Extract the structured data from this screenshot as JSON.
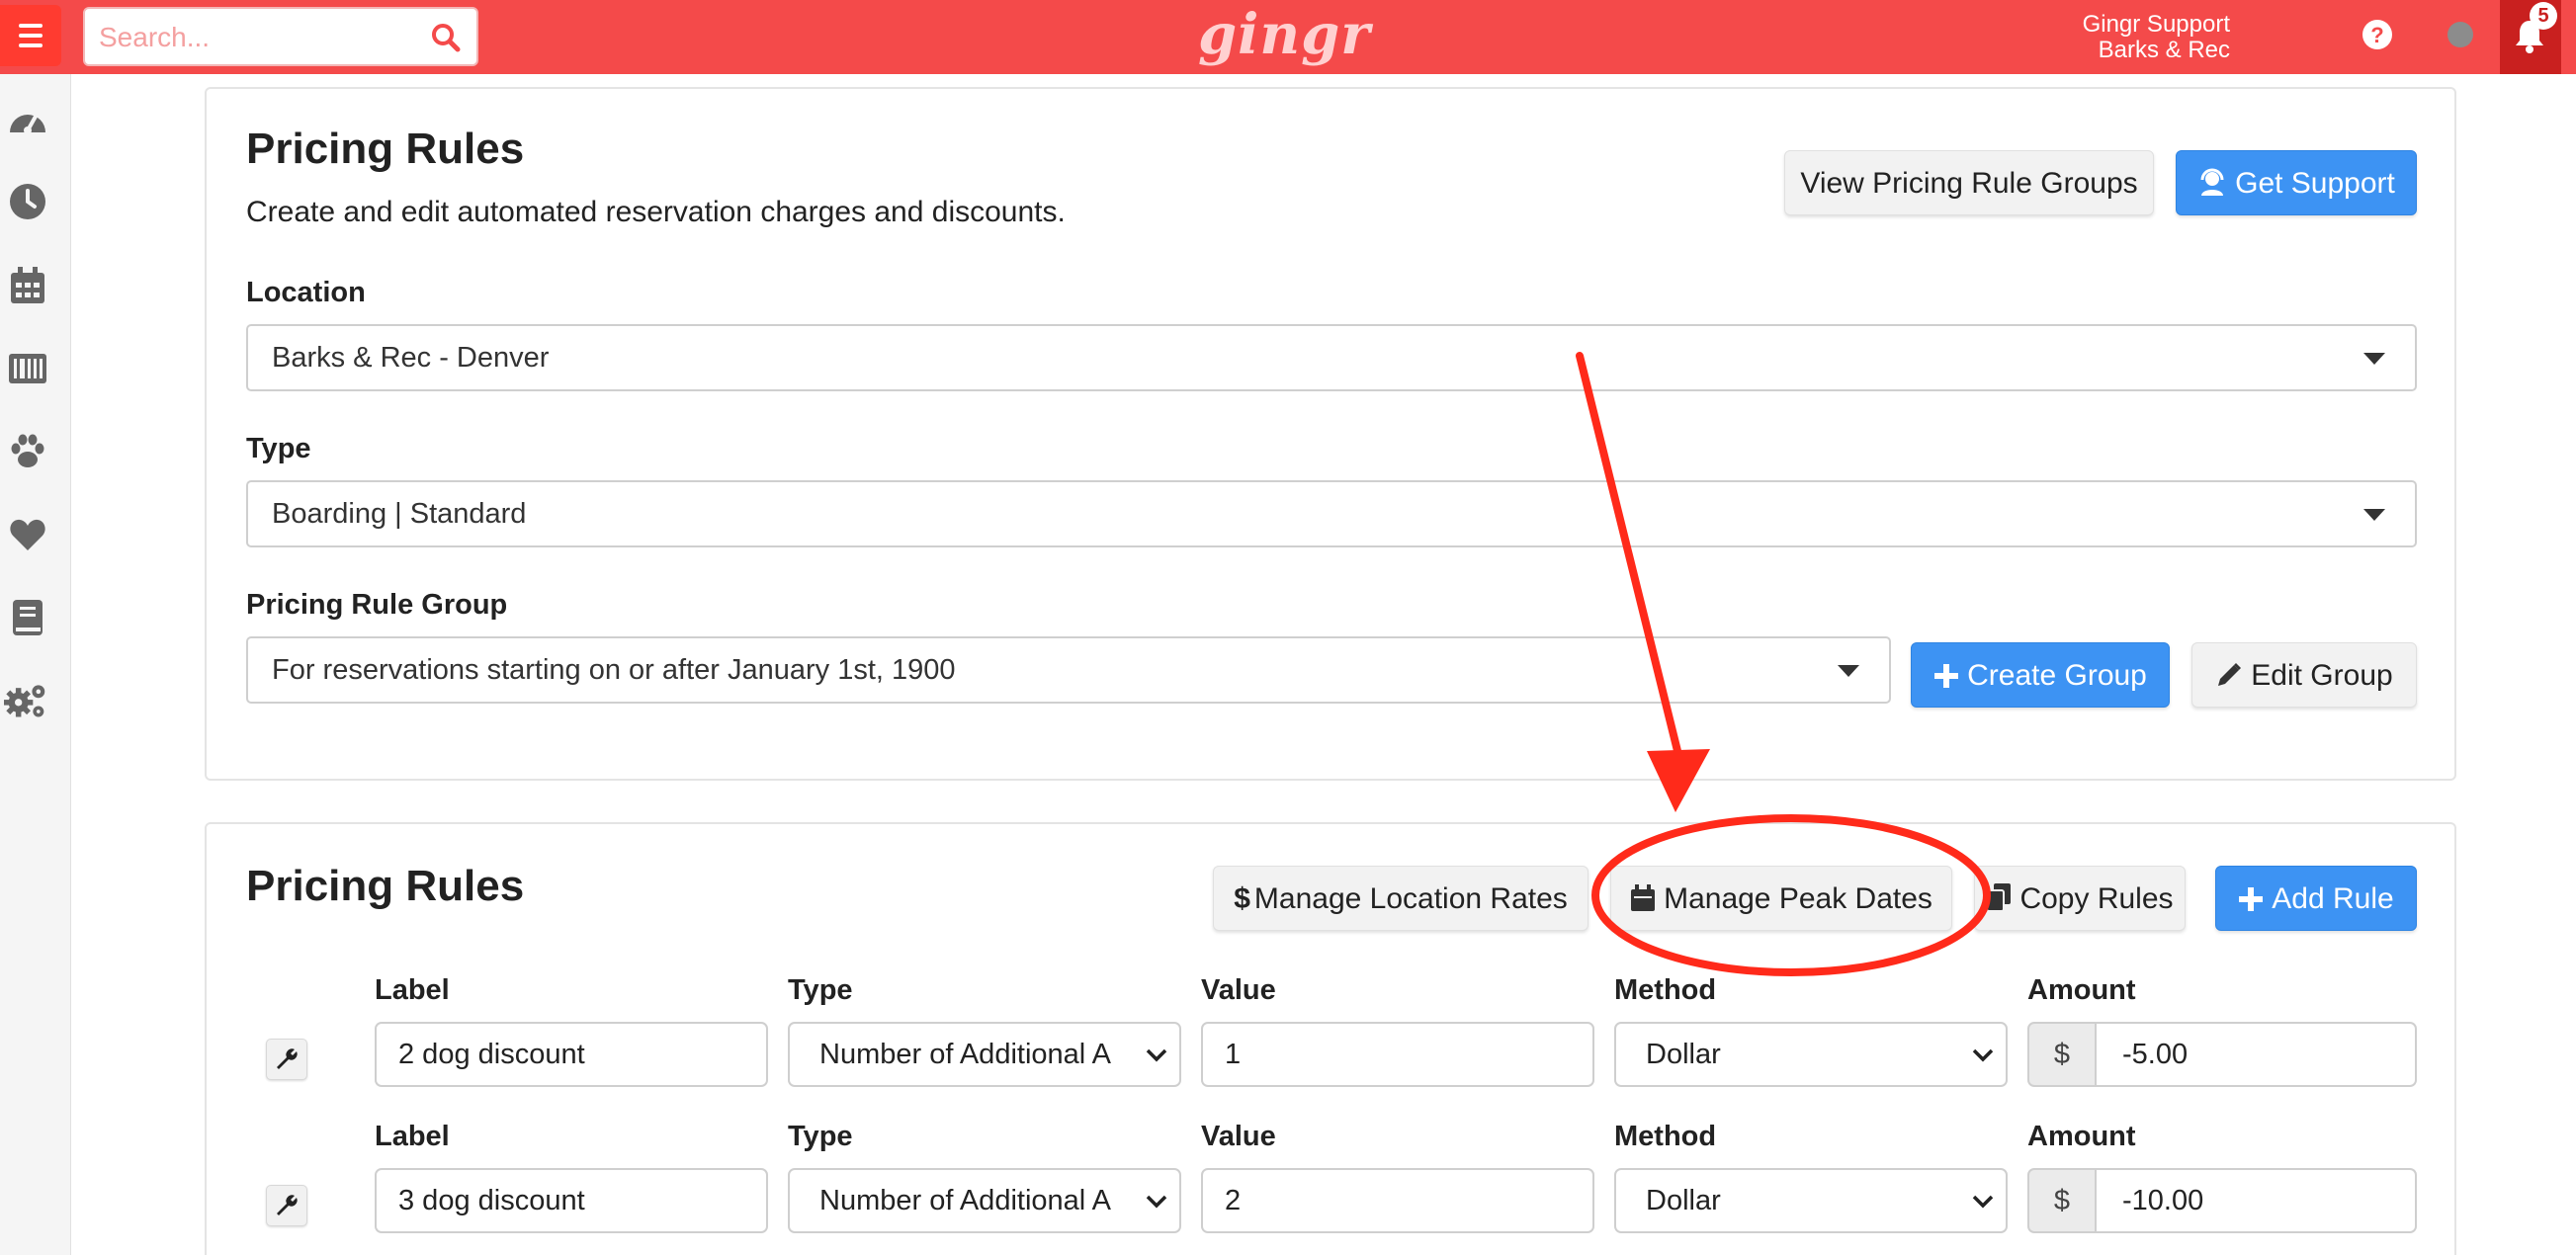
{
  "header": {
    "search_placeholder": "Search...",
    "logo_text": "gingr",
    "user_name": "Gingr Support",
    "user_org": "Barks & Rec",
    "notification_count": "5",
    "brand_color": "#f44a4a",
    "icons": [
      "menu-icon",
      "search-icon",
      "help-icon",
      "status-dot-icon",
      "cart-icon",
      "bell-icon"
    ]
  },
  "sidebar": {
    "icons": [
      "dashboard-icon",
      "clock-icon",
      "calendar-icon",
      "barcode-icon",
      "paw-icon",
      "heart-icon",
      "book-icon",
      "settings-icon"
    ]
  },
  "settings_panel": {
    "title": "Pricing Rules",
    "subtitle": "Create and edit automated reservation charges and discounts.",
    "view_groups_label": "View Pricing Rule Groups",
    "get_support_label": "Get Support",
    "location_label": "Location",
    "location_value": "Barks & Rec - Denver",
    "type_label": "Type",
    "type_value": "Boarding | Standard",
    "group_label": "Pricing Rule Group",
    "group_value": "For reservations starting on or after January 1st, 1900",
    "create_group_label": "Create Group",
    "edit_group_label": "Edit Group"
  },
  "rules_panel": {
    "title": "Pricing Rules",
    "manage_location_rates_label": "Manage Location Rates",
    "manage_peak_dates_label": "Manage Peak Dates",
    "copy_rules_label": "Copy Rules",
    "add_rule_label": "Add Rule",
    "columns": {
      "label": "Label",
      "type": "Type",
      "value": "Value",
      "method": "Method",
      "amount": "Amount"
    },
    "currency_symbol": "$",
    "rules": [
      {
        "label": "2 dog discount",
        "type": "Number of Additional A",
        "value": "1",
        "method": "Dollar",
        "amount": "-5.00"
      },
      {
        "label": "3 dog discount",
        "type": "Number of Additional A",
        "value": "2",
        "method": "Dollar",
        "amount": "-10.00"
      }
    ]
  },
  "annotation": {
    "color": "#ff2a1a",
    "target": "Manage Peak Dates"
  }
}
